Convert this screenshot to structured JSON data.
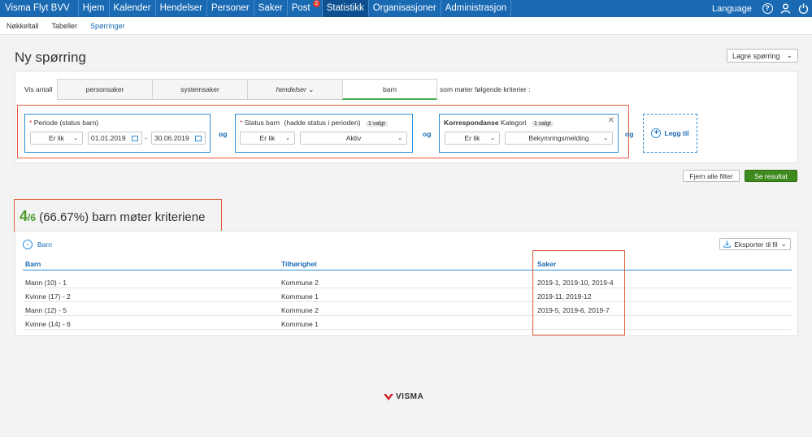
{
  "topnav": {
    "brand": "Visma Flyt BVV",
    "items": [
      "Hjem",
      "Kalender",
      "Hendelser",
      "Personer",
      "Saker",
      "Post",
      "Statistikk",
      "Organisasjoner",
      "Administrasjon"
    ],
    "active": "Statistikk",
    "post_badge": "2",
    "language": "Language",
    "icons": [
      "help-icon",
      "user-icon",
      "power-icon"
    ]
  },
  "subnav": {
    "tabs": [
      "Nøkkeltall",
      "Tabeller",
      "Spørringer"
    ],
    "active": "Spørringer"
  },
  "header": {
    "title": "Ny spørring",
    "save_label": "Lagre spørring"
  },
  "query": {
    "vis_antall": "Vis antall",
    "types": [
      "personsaker",
      "systemsaker",
      "hendelser",
      "barn"
    ],
    "active_type": "barn",
    "criteria_suffix": "som møter følgende kriterier :",
    "connector": "og",
    "criteria": [
      {
        "required": "*",
        "title": "Periode (status barn)",
        "operator": "Er lik",
        "from": "01.01.2019",
        "dash": "-",
        "to": "30.06.2019"
      },
      {
        "required": "*",
        "title": "Status barn",
        "subtitle": "(hadde status i perioden)",
        "count": "1 valgt",
        "operator": "Er lik",
        "value": "Aktiv"
      },
      {
        "title_bold": "Korrespondanse",
        "title": "Kategori",
        "count": "1 valgt",
        "operator": "Er lik",
        "value": "Bekymringsmelding"
      }
    ],
    "add_label": "Legg til",
    "clear_label": "Fjern alle filter",
    "result_label": "Se resultat"
  },
  "summary": {
    "count": "4",
    "total": "/6",
    "text": "(66.67%) barn møter kriteriene"
  },
  "results": {
    "group_label": "Barn",
    "export_label": "Eksporter til fil",
    "columns": [
      "Barn",
      "Tilhørighet",
      "Saker"
    ],
    "rows": [
      [
        "Mann (10) - 1",
        "Kommune 2",
        "2019-1, 2019-10, 2019-4"
      ],
      [
        "Kvinne (17) - 2",
        "Kommune 1",
        "2019-11, 2019-12"
      ],
      [
        "Mann (12) - 5",
        "Kommune 2",
        "2019-5, 2019-6, 2019-7"
      ],
      [
        "Kvinne (14) - 6",
        "Kommune 1",
        ""
      ]
    ]
  },
  "footer": {
    "logo": "VISMA"
  },
  "colors": {
    "nav": "#1969b3",
    "accent_green": "#3e8a1e",
    "highlight_red": "#e05a3a",
    "criteria_border": "#2e8fd9"
  }
}
